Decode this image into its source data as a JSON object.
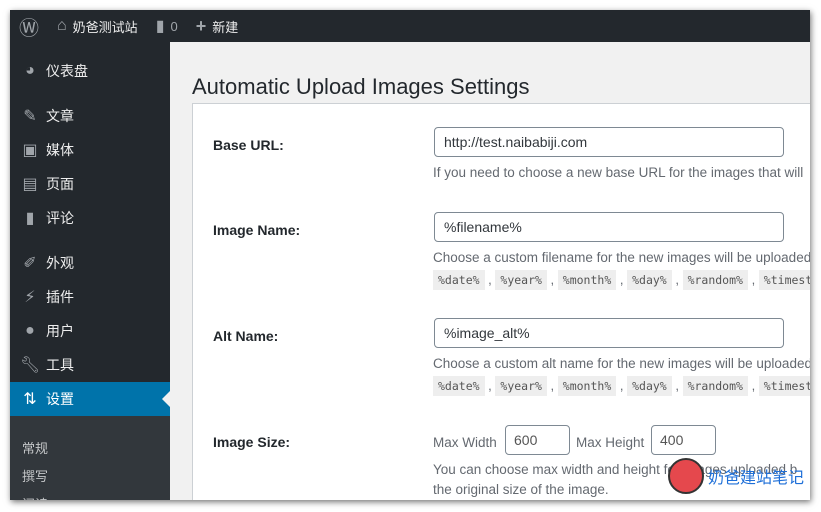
{
  "adminbar": {
    "site_name": "奶爸测试站",
    "comments": "0",
    "new": "新建"
  },
  "sidebar": {
    "items": [
      {
        "label": "仪表盘",
        "icon": "dashboard-icon"
      },
      {
        "label": "文章",
        "icon": "pin-icon"
      },
      {
        "label": "媒体",
        "icon": "media-icon"
      },
      {
        "label": "页面",
        "icon": "page-icon"
      },
      {
        "label": "评论",
        "icon": "comment-icon"
      },
      {
        "label": "外观",
        "icon": "brush-icon"
      },
      {
        "label": "插件",
        "icon": "plugin-icon"
      },
      {
        "label": "用户",
        "icon": "user-icon"
      },
      {
        "label": "工具",
        "icon": "wrench-icon"
      },
      {
        "label": "设置",
        "icon": "settings-icon"
      }
    ],
    "submenu": [
      "常规",
      "撰写",
      "阅读"
    ]
  },
  "page": {
    "title": "Automatic Upload Images Settings",
    "base_url": {
      "label": "Base URL:",
      "value": "http://test.naibabiji.com",
      "desc": "If you need to choose a new base URL for the images that will"
    },
    "image_name": {
      "label": "Image Name:",
      "value": "%filename%",
      "desc": "Choose a custom filename for the new images will be uploaded"
    },
    "alt_name": {
      "label": "Alt Name:",
      "value": "%image_alt%",
      "desc": "Choose a custom alt name for the new images will be uploaded"
    },
    "codes": [
      "%date%",
      "%year%",
      "%month%",
      "%day%",
      "%random%",
      "%timestamp%"
    ],
    "image_size": {
      "label": "Image Size:",
      "max_width_label": "Max Width",
      "max_width": "600",
      "max_height_label": "Max Height",
      "max_height": "400",
      "desc1": "You can choose max width and height for images uploaded b",
      "desc2": "the original size of the image."
    }
  },
  "watermark": "奶爸建站笔记"
}
